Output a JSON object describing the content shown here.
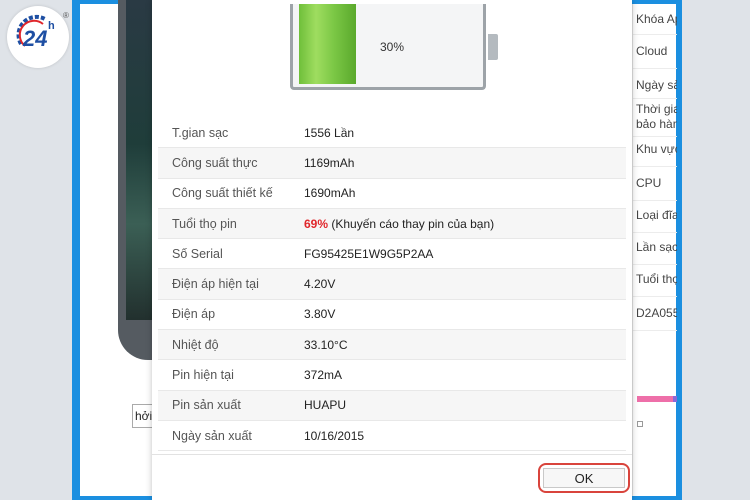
{
  "brand": {
    "logo_text": "24",
    "logo_suffix": "h",
    "registered": "®"
  },
  "battery": {
    "percent_text": "30%",
    "level": 0.3
  },
  "details": [
    {
      "label": "T.gian sạc",
      "value": "1556 Lần"
    },
    {
      "label": "Công suất thực",
      "value": "1169mAh"
    },
    {
      "label": "Công suất thiết kế",
      "value": "1690mAh"
    },
    {
      "label": "Tuổi thọ pin",
      "value_highlight": "69%",
      "value": " (Khuyến cáo thay pin của bạn)"
    },
    {
      "label": "Số Serial",
      "value": "FG95425E1W9G5P2AA"
    },
    {
      "label": "Điện áp hiện tại",
      "value": "4.20V"
    },
    {
      "label": "Điện áp",
      "value": "3.80V"
    },
    {
      "label": "Nhiệt độ",
      "value": "33.10°C"
    },
    {
      "label": "Pin hiện tại",
      "value": "372mA"
    },
    {
      "label": "Pin sản xuất",
      "value": "HUAPU"
    },
    {
      "label": "Ngày sản xuất",
      "value": "10/16/2015"
    }
  ],
  "dialog": {
    "ok_label": "OK"
  },
  "right_panel": {
    "items": [
      "Khóa Ap",
      "Cloud",
      "Ngày sả",
      "Thời gia",
      "bảo hàn",
      "Khu vực",
      "CPU",
      "Loại đĩa",
      "Lần sạc",
      "Tuổi thọ",
      "D2A055"
    ]
  },
  "left_panel": {
    "partial_text": "hởi"
  },
  "colors": {
    "frame": "#1b8fe0",
    "warning": "#e0262b",
    "ok_highlight": "#d9443c"
  }
}
